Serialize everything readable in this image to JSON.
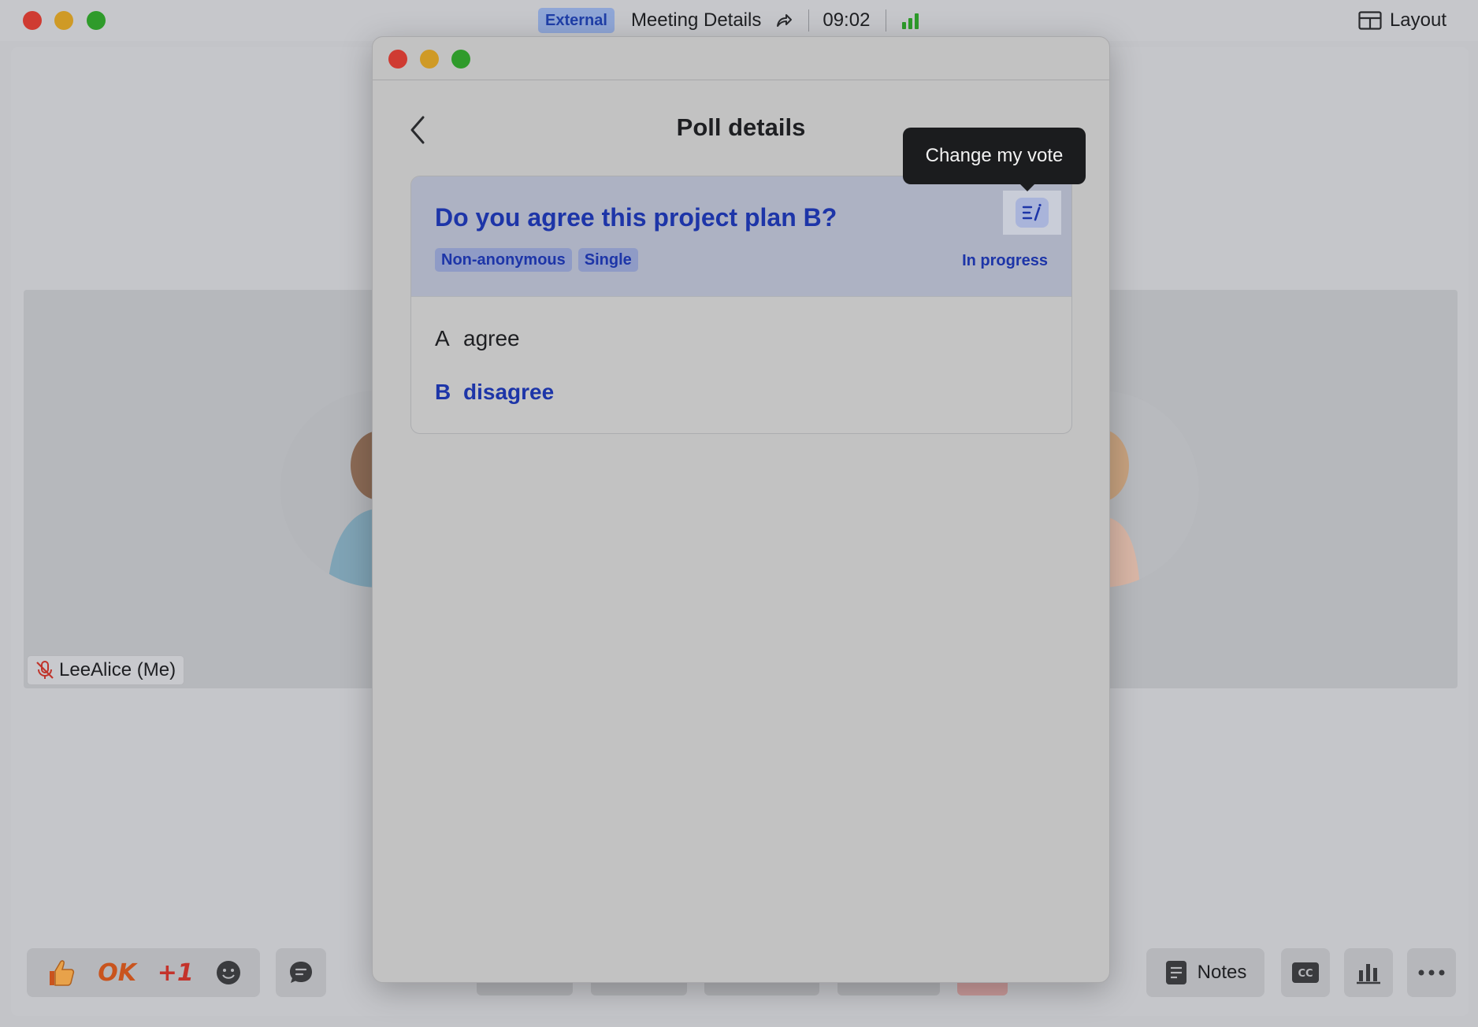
{
  "app": {
    "external_badge": "External",
    "meeting_title": "Meeting Details",
    "timer": "09:02",
    "layout_label": "Layout"
  },
  "participants": {
    "self_name": "LeeAlice (Me)"
  },
  "toolbar": {
    "reaction_ok": "OK",
    "reaction_plus_one": "+1",
    "notes_label": "Notes",
    "cc_label": "CC"
  },
  "poll": {
    "heading": "Poll details",
    "question": "Do you agree this project plan B?",
    "tags": [
      "Non-anonymous",
      "Single"
    ],
    "status": "In progress",
    "options": [
      {
        "letter": "A",
        "text": "agree",
        "selected": false
      },
      {
        "letter": "B",
        "text": "disagree",
        "selected": true
      }
    ],
    "tooltip": "Change my vote"
  },
  "colors": {
    "accent": "#1d35a8",
    "signal": "#2d9b2a",
    "tooltip_bg": "#1b1c1e"
  }
}
